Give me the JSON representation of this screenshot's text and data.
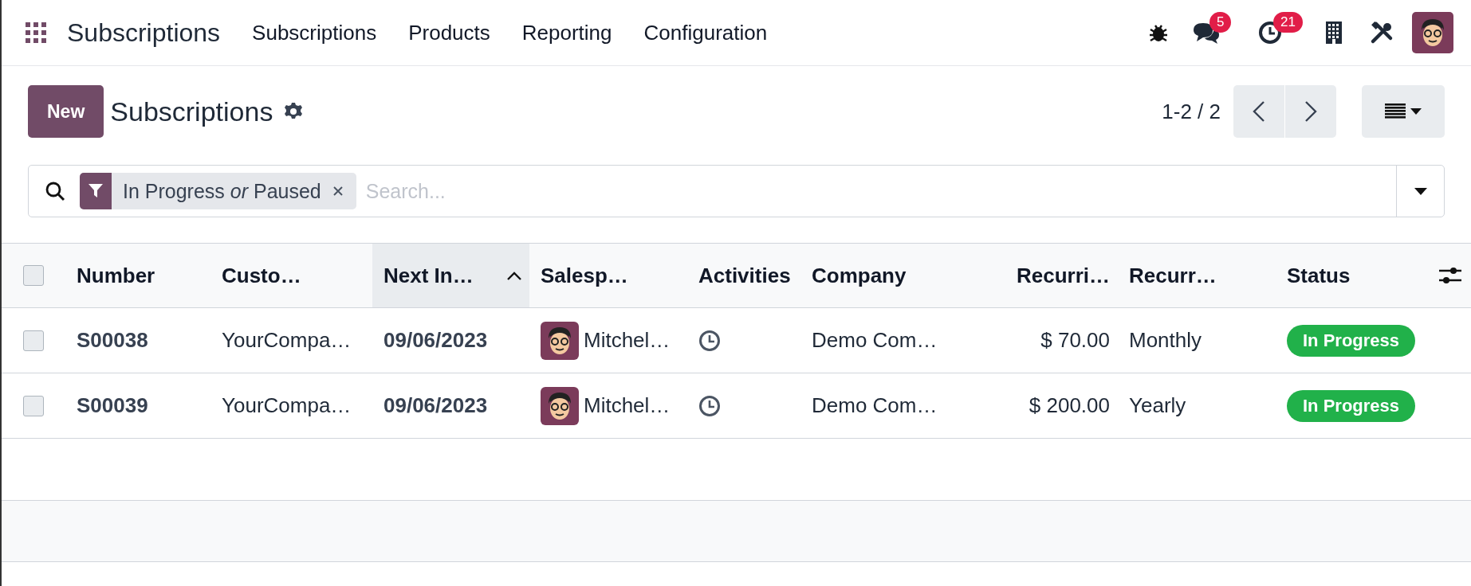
{
  "navbar": {
    "app_name": "Subscriptions",
    "menu": [
      "Subscriptions",
      "Products",
      "Reporting",
      "Configuration"
    ],
    "message_count": "5",
    "activity_count": "21"
  },
  "control_panel": {
    "new_button": "New",
    "title": "Subscriptions",
    "pager": "1-2 / 2"
  },
  "search": {
    "facet": "In Progress *or* Paused",
    "placeholder": "Search..."
  },
  "table": {
    "select_all_checked": false,
    "columns": [
      {
        "label": "Number",
        "kind": "text",
        "sorted": false
      },
      {
        "label": "Custo…",
        "kind": "text",
        "sorted": false
      },
      {
        "label": "Next In…",
        "kind": "text",
        "sorted": true
      },
      {
        "label": "Salesp…",
        "kind": "text",
        "sorted": false
      },
      {
        "label": "Activities",
        "kind": "text",
        "sorted": false
      },
      {
        "label": "Company",
        "kind": "text",
        "sorted": false
      },
      {
        "label": "Recurri…",
        "kind": "amount",
        "sorted": false
      },
      {
        "label": "Recurr…",
        "kind": "text",
        "sorted": false
      },
      {
        "label": "Status",
        "kind": "text",
        "sorted": false
      }
    ],
    "rows": [
      {
        "checked": false,
        "number": "S00038",
        "customer": "YourCompa…",
        "next_invoice": "09/06/2023",
        "salesperson": "Mitchel…",
        "company": "Demo Com…",
        "recurring_price": "$ 70.00",
        "recurrence": "Monthly",
        "status": "In Progress",
        "color": "#21b14a"
      },
      {
        "checked": false,
        "number": "S00039",
        "customer": "YourCompa…",
        "next_invoice": "09/06/2023",
        "salesperson": "Mitchel…",
        "company": "Demo Com…",
        "recurring_price": "$ 200.00",
        "recurrence": "Yearly",
        "status": "In Progress",
        "color": "#21b14a"
      }
    ]
  }
}
